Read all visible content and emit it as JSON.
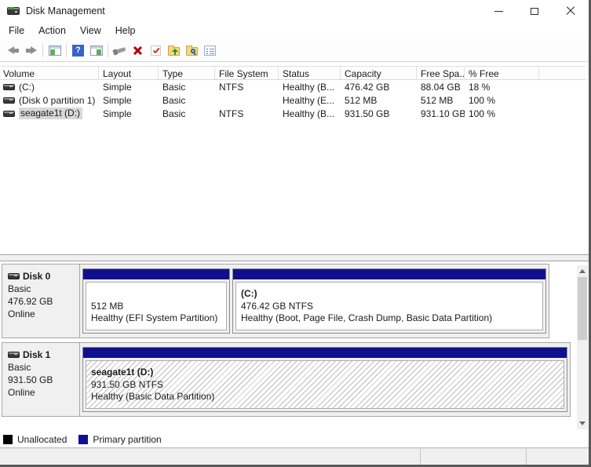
{
  "window": {
    "title": "Disk Management"
  },
  "menu_bar": {
    "items": [
      "File",
      "Action",
      "View",
      "Help"
    ]
  },
  "toolbar": {
    "icons": [
      "back-icon",
      "forward-icon",
      "console-tree-icon",
      "help-icon",
      "action-pane-icon",
      "remote-tool-icon",
      "delete-icon",
      "check-icon",
      "folder-up-icon",
      "folder-search-icon",
      "checklist-icon"
    ]
  },
  "volume_list": {
    "columns": {
      "volume": "Volume",
      "layout": "Layout",
      "type": "Type",
      "fs": "File System",
      "status": "Status",
      "capacity": "Capacity",
      "free_space": "Free Spa...",
      "pct_free": "% Free"
    },
    "rows": [
      {
        "volume": "(C:)",
        "layout": "Simple",
        "type": "Basic",
        "fs": "NTFS",
        "status": "Healthy (B...",
        "capacity": "476.42 GB",
        "free_space": "88.04 GB",
        "pct_free": "18 %"
      },
      {
        "volume": "(Disk 0 partition 1)",
        "layout": "Simple",
        "type": "Basic",
        "fs": "",
        "status": "Healthy (E...",
        "capacity": "512 MB",
        "free_space": "512 MB",
        "pct_free": "100 %"
      },
      {
        "volume": "seagate1t (D:)",
        "layout": "Simple",
        "type": "Basic",
        "fs": "NTFS",
        "status": "Healthy (B...",
        "capacity": "931.50 GB",
        "free_space": "931.10 GB",
        "pct_free": "100 %"
      }
    ]
  },
  "disks": [
    {
      "label": "Disk 0",
      "kind": "Basic",
      "size": "476.92 GB",
      "status": "Online",
      "partitions": [
        {
          "name": "",
          "size_fs": "512 MB",
          "health": "Healthy (EFI System Partition)"
        },
        {
          "name": "(C:)",
          "size_fs": "476.42 GB NTFS",
          "health": "Healthy (Boot, Page File, Crash Dump, Basic Data Partition)"
        }
      ]
    },
    {
      "label": "Disk 1",
      "kind": "Basic",
      "size": "931.50 GB",
      "status": "Online",
      "partitions": [
        {
          "name": "seagate1t (D:)",
          "size_fs": "931.50 GB NTFS",
          "health": "Healthy (Basic Data Partition)"
        }
      ]
    }
  ],
  "legend": {
    "unallocated": "Unallocated",
    "primary": "Primary partition"
  },
  "colors": {
    "primary_partition": "#10108F",
    "unallocated": "#000000"
  }
}
